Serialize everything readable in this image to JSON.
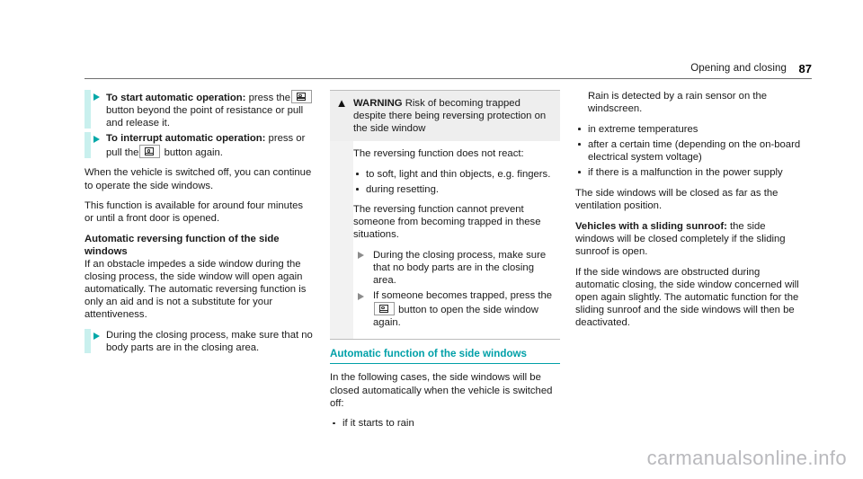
{
  "header": {
    "section_title": "Opening and closing",
    "page_number": "87"
  },
  "icons": {
    "window_button": "window-button-icon",
    "warning_triangle": "warning-triangle-icon",
    "bullet_triangle": "triangle-bullet-icon",
    "bullet_dot": "dot-bullet-icon"
  },
  "colors": {
    "teal": "#00a0a8",
    "teal_bar": "#c9f0ee",
    "warning_header_bg": "#eeeeee",
    "warning_border": "#bdbdbd",
    "watermark": "#b9b9bd"
  },
  "column_left": {
    "steps": [
      {
        "label": "To start automatic operation:",
        "text_before_icon": "press the",
        "text_after_icon": "button beyond the point of resistance or pull and release it."
      },
      {
        "label": "To interrupt automatic operation:",
        "text_before_icon": "press or pull the",
        "text_after_icon": "button again."
      }
    ],
    "paragraphs": [
      "When the vehicle is switched off, you can continue to operate the side windows.",
      "This function is available for around four minutes or until a front door is opened."
    ],
    "subheading": "Automatic reversing function of the side windows",
    "subheading_body": "If an obstacle impedes a side window during the closing process, the side window will open again automatically. The automatic reversing function is only an aid and is not a substitute for your attentiveness.",
    "final_step": "During the closing process, make sure that no body parts are in the closing area."
  },
  "column_middle": {
    "warning": {
      "symbol": "▲",
      "title": "WARNING",
      "title_rest": "Risk of becoming trapped despite there being reversing protection on the side window",
      "intro": "The reversing function does not react:",
      "bullets": [
        "to soft, light and thin objects, e.g. fingers.",
        "during resetting."
      ],
      "note": "The reversing function cannot prevent someone from becoming trapped in these situations.",
      "steps": [
        {
          "text_before_icon": "During the closing process, make sure that no body parts are in the closing area.",
          "text_after_icon": ""
        },
        {
          "text_before_icon": "If someone becomes trapped, press the",
          "text_after_icon": "button to open the side window again."
        }
      ]
    },
    "section_heading": "Automatic function of the side windows",
    "intro": "In the following cases, the side windows will be closed automatically when the vehicle is switched off:",
    "bullets": [
      "if it starts to rain"
    ]
  },
  "column_right": {
    "rain_note": "Rain is detected by a rain sensor on the windscreen.",
    "bullets": [
      "in extreme temperatures",
      "after a certain time (depending on the on-board electrical system voltage)",
      "if there is a malfunction in the power supply"
    ],
    "paragraphs": [
      "The side windows will be closed as far as the ventilation position."
    ],
    "sunroof_label": "Vehicles with a sliding sunroof:",
    "sunroof_text": "the side windows will be closed completely if the sliding sunroof is open.",
    "closing_paragraph": "If the side windows are obstructed during automatic closing, the side window concerned will open again slightly. The automatic function for the sliding sunroof and the side windows will then be deactivated."
  },
  "watermark": {
    "text": "carmanualsonline.info"
  }
}
